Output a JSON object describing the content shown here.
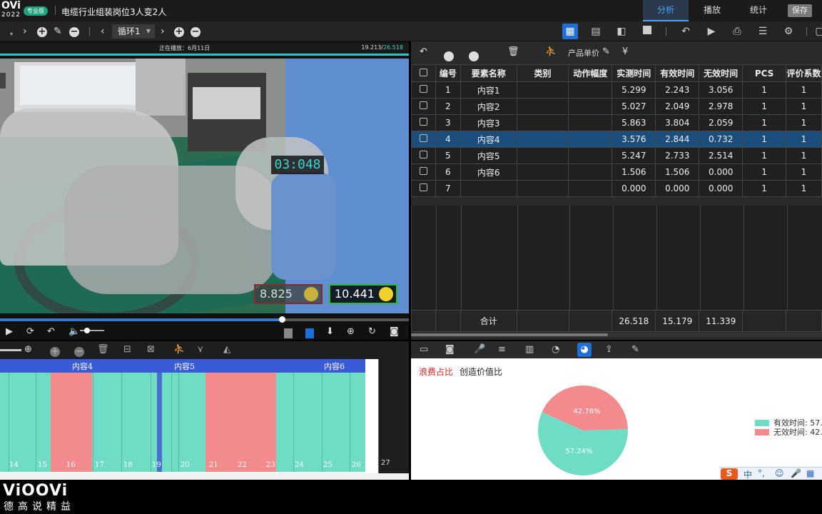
{
  "app": {
    "logo": "OVi",
    "year": "2022",
    "edition": "专业版",
    "title": "电缆行业组装岗位3人变2人",
    "tabs": [
      {
        "label": "分析",
        "active": true
      },
      {
        "label": "播放",
        "active": false
      },
      {
        "label": "统计",
        "active": false
      }
    ],
    "save_label": "保存"
  },
  "toolbar": {
    "cycle_value": "循环1"
  },
  "video": {
    "status_playing": "正在播放：6月11日",
    "time_current": "19.213/",
    "time_total": "26.518",
    "timer": "03:048",
    "badge_bad": "8.825",
    "badge_good": "10.441",
    "progress": 0.69
  },
  "table": {
    "toolbar_price_label": "产品单价",
    "columns": [
      "编号",
      "要素名称",
      "类别",
      "动作幅度",
      "实测时间",
      "有效时间",
      "无效时间",
      "PCS",
      "评价系数"
    ],
    "rows": [
      {
        "id": "1",
        "name": "内容1",
        "cat": "",
        "amp": "",
        "measured": "5.299",
        "effective": "2.243",
        "ineffective": "3.056",
        "pcs": "1",
        "coef": "1",
        "selected": false
      },
      {
        "id": "2",
        "name": "内容2",
        "cat": "",
        "amp": "",
        "measured": "5.027",
        "effective": "2.049",
        "ineffective": "2.978",
        "pcs": "1",
        "coef": "1",
        "selected": false
      },
      {
        "id": "3",
        "name": "内容3",
        "cat": "",
        "amp": "",
        "measured": "5.863",
        "effective": "3.804",
        "ineffective": "2.059",
        "pcs": "1",
        "coef": "1",
        "selected": false
      },
      {
        "id": "4",
        "name": "内容4",
        "cat": "",
        "amp": "",
        "measured": "3.576",
        "effective": "2.844",
        "ineffective": "0.732",
        "pcs": "1",
        "coef": "1",
        "selected": true
      },
      {
        "id": "5",
        "name": "内容5",
        "cat": "",
        "amp": "",
        "measured": "5.247",
        "effective": "2.733",
        "ineffective": "2.514",
        "pcs": "1",
        "coef": "1",
        "selected": false
      },
      {
        "id": "6",
        "name": "内容6",
        "cat": "",
        "amp": "",
        "measured": "1.506",
        "effective": "1.506",
        "ineffective": "0.000",
        "pcs": "1",
        "coef": "1",
        "selected": false
      },
      {
        "id": "7",
        "name": "",
        "cat": "",
        "amp": "",
        "measured": "0.000",
        "effective": "0.000",
        "ineffective": "0.000",
        "pcs": "1",
        "coef": "1",
        "selected": false
      }
    ],
    "total": {
      "label": "合计",
      "measured": "26.518",
      "effective": "15.179",
      "ineffective": "11.339"
    }
  },
  "timeline": {
    "labels": [
      "内容4",
      "内容5",
      "内容6"
    ],
    "ticks": [
      "14",
      "15",
      "16",
      "17",
      "18",
      "19",
      "20",
      "21",
      "22",
      "23",
      "24",
      "25",
      "26"
    ],
    "tick_end": "27"
  },
  "chart_tabs": {
    "waste": "浪费占比",
    "value": "创造价值比"
  },
  "chart_data": {
    "type": "pie",
    "slices": [
      {
        "label": "有效时间",
        "value": 57.24,
        "display": "57.24%",
        "color": "#6fdcc6"
      },
      {
        "label": "无效时间",
        "value": 42.76,
        "display": "42.76%",
        "color": "#f28a8e"
      }
    ],
    "legend": [
      "有效时间: 57.",
      "无效时间: 42."
    ],
    "legend_position": "right"
  },
  "ime": {
    "label": "中"
  },
  "footer": {
    "brand": "ViOOVi",
    "slogan": "德高说精益"
  },
  "colors": {
    "accent": "#1f6fd6",
    "effective": "#6fdcc6",
    "ineffective": "#f28a8e",
    "timeline_head": "#3a5bd7"
  }
}
